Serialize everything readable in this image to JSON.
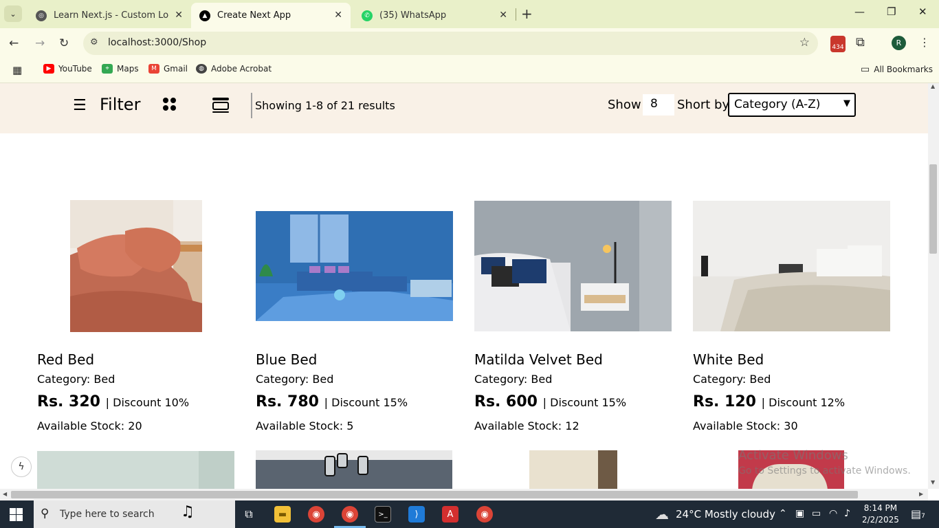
{
  "browser": {
    "tabs": [
      {
        "title": "Learn Next.js - Custom Localhos",
        "active": false
      },
      {
        "title": "Create Next App",
        "active": true
      },
      {
        "title": "(35) WhatsApp",
        "active": false
      }
    ],
    "url": "localhost:3000/Shop",
    "extension_badge": "434",
    "profile_initial": "R",
    "bookmarks": [
      "YouTube",
      "Maps",
      "Gmail",
      "Adobe Acrobat"
    ],
    "all_bookmarks": "All Bookmarks"
  },
  "filterbar": {
    "filter_label": "Filter",
    "results_text": "Showing 1-8 of 21 results",
    "show_label": "Show",
    "show_value": "8",
    "sort_label": "Short by",
    "sort_value": "Category (A-Z)"
  },
  "products": [
    {
      "name": "Red Bed",
      "category": "Category: Bed",
      "price": "Rs. 320",
      "discount": "| Discount 10%",
      "stock": "Available Stock: 20"
    },
    {
      "name": "Blue Bed",
      "category": "Category: Bed",
      "price": "Rs. 780",
      "discount": "| Discount 15%",
      "stock": "Available Stock: 5"
    },
    {
      "name": "Matilda Velvet Bed",
      "category": "Category: Bed",
      "price": "Rs. 600",
      "discount": "| Discount 15%",
      "stock": "Available Stock: 12"
    },
    {
      "name": "White Bed",
      "category": "Category: Bed",
      "price": "Rs. 120",
      "discount": "| Discount 12%",
      "stock": "Available Stock: 30"
    }
  ],
  "watermark": {
    "line1": "Activate Windows",
    "line2": "Go to Settings to activate Windows."
  },
  "taskbar": {
    "search_placeholder": "Type here to search",
    "weather": "24°C  Mostly cloudy",
    "time": "8:14 PM",
    "date": "2/2/2025",
    "notification_count": "7"
  }
}
